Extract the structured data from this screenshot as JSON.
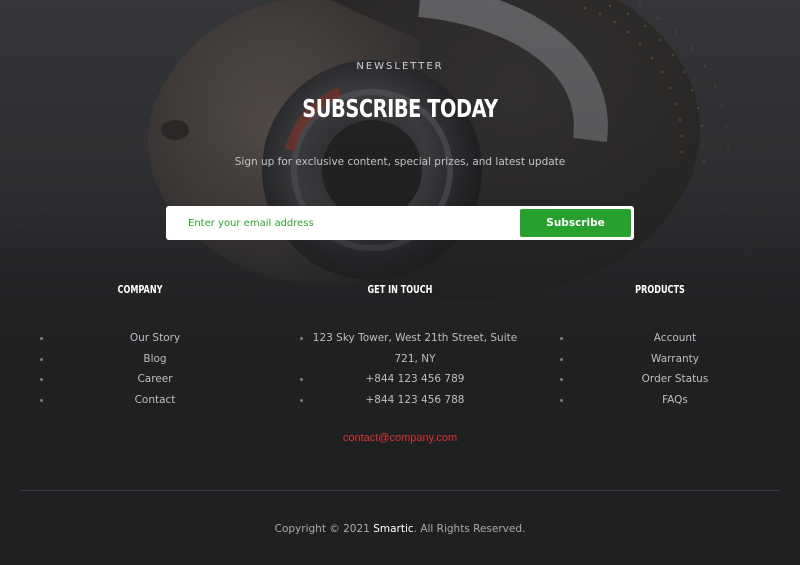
{
  "newsletter": {
    "eyebrow": "NEWSLETTER",
    "title": "SUBSCRIBE TODAY",
    "subtitle": "Sign up for exclusive content, special prizes, and latest update",
    "email_placeholder": "Enter your email address",
    "subscribe_label": "Subscribe"
  },
  "columns": {
    "company": {
      "title": "COMPANY",
      "items": [
        "Our Story",
        "Blog",
        "Career",
        "Contact"
      ]
    },
    "get_in_touch": {
      "title": "GET IN TOUCH",
      "address_line1": "123 Sky Tower, West 21th Street, Suite",
      "address_line2": "721, NY",
      "phone1": "+844 123 456 789",
      "phone2": "+844 123 456 788"
    },
    "products": {
      "title": "PRODUCTS",
      "items": [
        "Account",
        "Warranty",
        "Order Status",
        "FAQs"
      ]
    }
  },
  "contact_email": "contact@company.com",
  "footer": {
    "copyright_prefix": "Copyright © 2021",
    "brand": "Smartic",
    "copyright_suffix": ". All Rights Reserved."
  },
  "colors": {
    "accent": "#27a02d",
    "link": "#d9362f",
    "background": "#1f2022"
  },
  "hero_image": "man-with-headphones"
}
